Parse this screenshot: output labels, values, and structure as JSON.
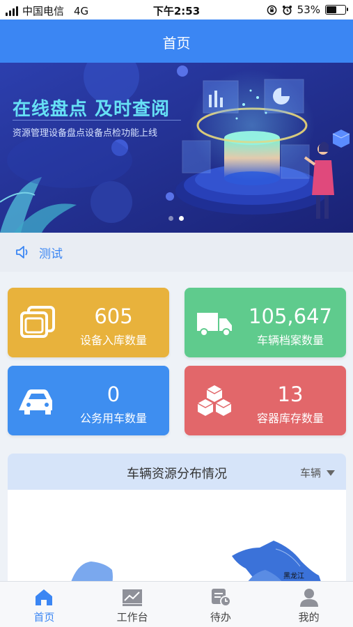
{
  "status_bar": {
    "carrier": "中国电信",
    "network": "4G",
    "time": "下午2:53",
    "battery_text": "53%",
    "battery_level": 0.53
  },
  "nav": {
    "title": "首页"
  },
  "banner": {
    "headline": "在线盘点  及时查阅",
    "subline": "资源管理设备盘点设备点检功能上线",
    "slide_count": 2,
    "active_slide": 2
  },
  "notice": {
    "icon": "speaker-icon",
    "text": "测试"
  },
  "stats": [
    {
      "value": "605",
      "label": "设备入库数量",
      "color": "#e8b23c",
      "icon": "stack-icon"
    },
    {
      "value": "105,647",
      "label": "车辆档案数量",
      "color": "#5fcb8d",
      "icon": "truck-icon"
    },
    {
      "value": "0",
      "label": "公务用车数量",
      "color": "#3e8ef0",
      "icon": "car-icon"
    },
    {
      "value": "13",
      "label": "容器库存数量",
      "color": "#e2676a",
      "icon": "boxes-icon"
    }
  ],
  "distribution": {
    "title": "车辆资源分布情况",
    "filter_label": "车辆",
    "map_label": "黑龙江"
  },
  "tabs": [
    {
      "label": "首页",
      "icon": "home-icon",
      "active": true
    },
    {
      "label": "工作台",
      "icon": "chart-icon",
      "active": false
    },
    {
      "label": "待办",
      "icon": "todo-icon",
      "active": false
    },
    {
      "label": "我的",
      "icon": "user-icon",
      "active": false
    }
  ],
  "colors": {
    "primary": "#3b86f3",
    "map_fill": "#3b72d9"
  }
}
